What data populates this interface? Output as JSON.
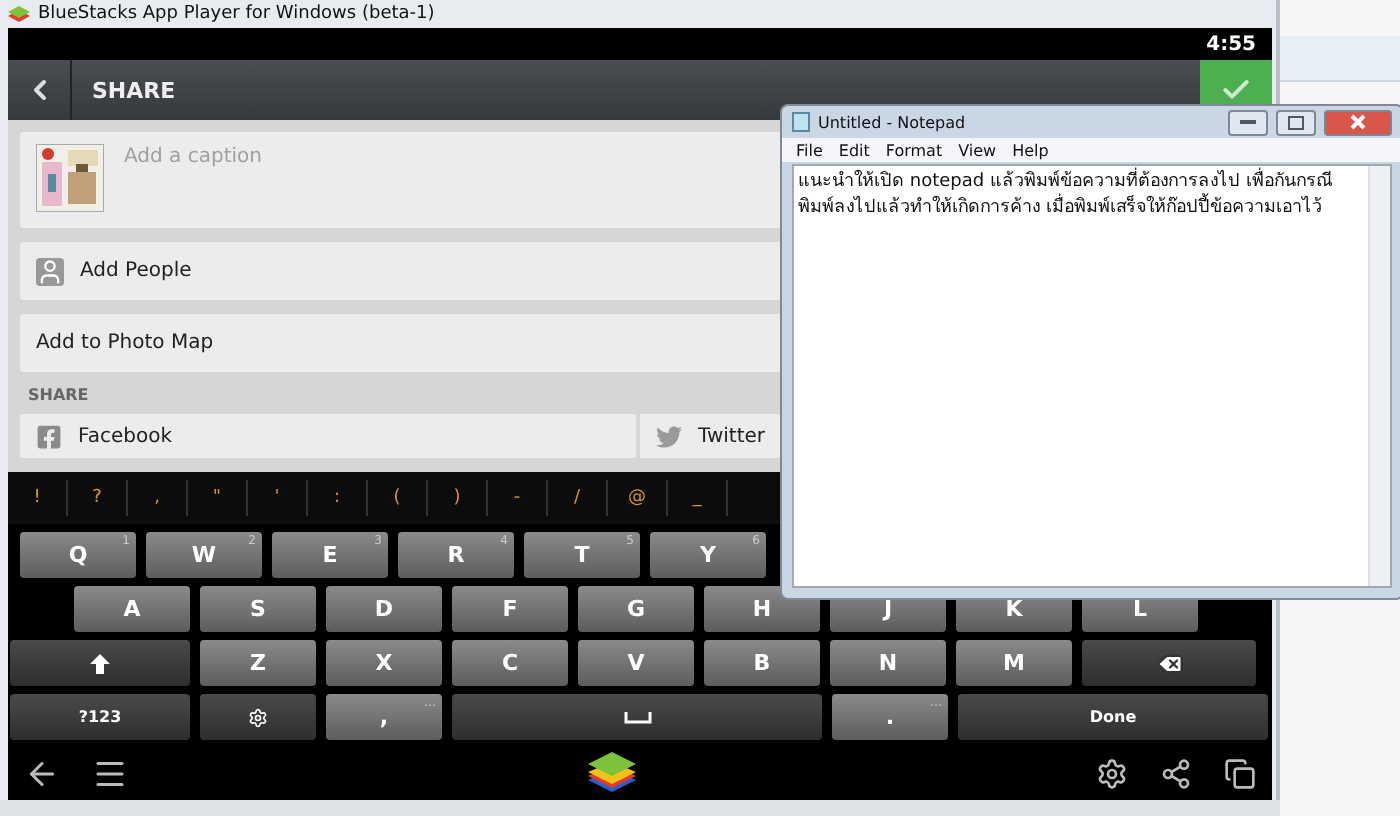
{
  "bluestacks": {
    "title": "BlueStacks App Player for Windows (beta-1)",
    "status_time": "4:55",
    "action_bar": {
      "title": "SHARE"
    },
    "caption": {
      "placeholder": "Add a caption"
    },
    "rows": [
      {
        "label": "Add People",
        "kind": "people"
      },
      {
        "label": "Add to Photo Map",
        "kind": "plain"
      }
    ],
    "share_heading": "SHARE",
    "share_targets": [
      {
        "label": "Facebook",
        "kind": "facebook"
      },
      {
        "label": "Twitter",
        "kind": "twitter"
      }
    ],
    "keyboard": {
      "suggestions": [
        "!",
        "?",
        ",",
        "\"",
        "'",
        ":",
        "(",
        ")",
        "-",
        "/",
        "@",
        "_"
      ],
      "rows": [
        [
          {
            "kind": "letter",
            "label": "Q",
            "hint": "1"
          },
          {
            "kind": "letter",
            "label": "W",
            "hint": "2"
          },
          {
            "kind": "letter",
            "label": "E",
            "hint": "3"
          },
          {
            "kind": "letter",
            "label": "R",
            "hint": "4"
          },
          {
            "kind": "letter",
            "label": "T",
            "hint": "5"
          },
          {
            "kind": "letter",
            "label": "Y",
            "hint": "6"
          }
        ],
        [
          {
            "kind": "letter",
            "label": "A"
          },
          {
            "kind": "letter",
            "label": "S"
          },
          {
            "kind": "letter",
            "label": "D"
          },
          {
            "kind": "letter",
            "label": "F"
          },
          {
            "kind": "letter",
            "label": "G"
          },
          {
            "kind": "letter",
            "label": "H"
          },
          {
            "kind": "letter",
            "label": "J"
          },
          {
            "kind": "letter",
            "label": "K"
          },
          {
            "kind": "letter",
            "label": "L"
          }
        ],
        [
          {
            "kind": "shift"
          },
          {
            "kind": "letter",
            "label": "Z"
          },
          {
            "kind": "letter",
            "label": "X"
          },
          {
            "kind": "letter",
            "label": "C"
          },
          {
            "kind": "letter",
            "label": "V"
          },
          {
            "kind": "letter",
            "label": "B"
          },
          {
            "kind": "letter",
            "label": "N"
          },
          {
            "kind": "letter",
            "label": "M"
          },
          {
            "kind": "backspace"
          }
        ],
        [
          {
            "kind": "wide",
            "label": "?123"
          },
          {
            "kind": "settings"
          },
          {
            "kind": "letter",
            "label": ",",
            "hint": "…"
          },
          {
            "kind": "space"
          },
          {
            "kind": "letter",
            "label": ".",
            "hint": "…"
          },
          {
            "kind": "action",
            "label": "Done"
          }
        ]
      ]
    }
  },
  "notepad": {
    "title": "Untitled - Notepad",
    "menu": [
      "File",
      "Edit",
      "Format",
      "View",
      "Help"
    ],
    "text": "แนะนำให้เปิด notepad แล้วพิมพ์ข้อความที่ต้องการลงไป เพื่อกันกรณีพิมพ์ลงไปแล้วทำให้เกิดการค้าง เมื่อพิมพ์เสร็จให้ก๊อปปี้ข้อความเอาไว้"
  }
}
